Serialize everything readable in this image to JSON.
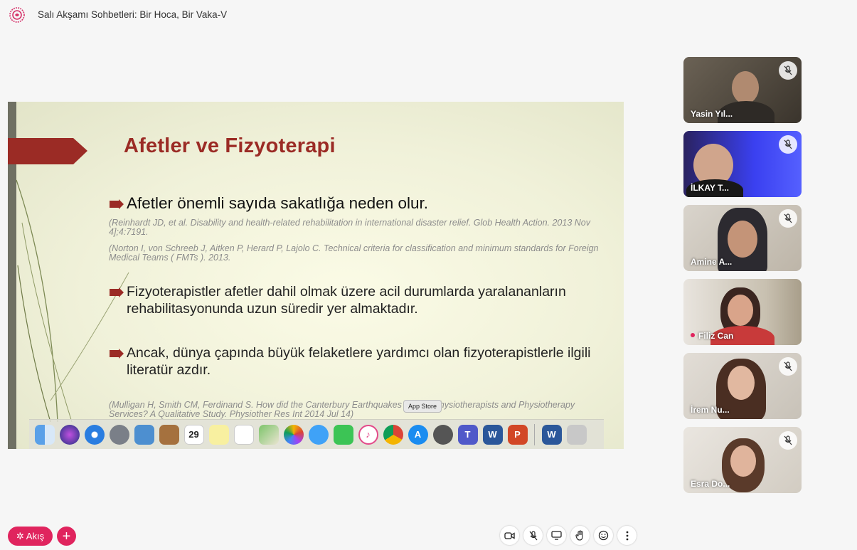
{
  "app": {
    "title": "Salı Akşamı Sohbetleri: Bir Hoca, Bir Vaka-V",
    "accent": "#e0245e"
  },
  "slide": {
    "title": "Afetler ve Fizyoterapi",
    "bullets": [
      "Afetler önemli sayıda sakatlığa neden olur.",
      "Fizyoterapistler afetler dahil olmak üzere acil durumlarda yaralananların rehabilitasyonunda uzun süredir yer almaktadır.",
      "Ancak, dünya çapında büyük felaketlere yardımcı olan fizyoterapistlerle ilgili literatür azdır."
    ],
    "references": [
      "(Reinhardt JD, et al. Disability and health-related rehabilitation in international disaster relief. Glob Health Action. 2013 Nov 4];4:7191.",
      "(Norton I, von Schreeb J, Aitken P, Herard P, Lajolo C. Technical criteria for classification and minimum standards for Foreign Medical Teams ( FMTs ). 2013.",
      "(Mulligan H, Smith CM, Ferdinand S. How did the Canterbury Earthquakes Impact Physiotherapists and Physiotherapy Services? A Qualitative Study. Physiother Res Int 2014 Jul 14)"
    ]
  },
  "dock": {
    "tooltip": "App Store",
    "calendar_day": "29",
    "icons": [
      "finder-icon",
      "siri-icon",
      "safari-icon",
      "launchpad-icon",
      "preview-icon",
      "contacts-icon",
      "calendar-icon",
      "notes-icon",
      "reminders-icon",
      "maps-icon",
      "photos-icon",
      "messages-icon",
      "facetime-icon",
      "itunes-icon",
      "chrome-icon",
      "app-store-icon",
      "system-preferences-icon",
      "teams-icon",
      "word-icon",
      "powerpoint-icon",
      "word-doc-icon",
      "trash-icon"
    ]
  },
  "participants": [
    {
      "name": "Yasin Yıl...",
      "muted": true
    },
    {
      "name": "İLKAY T...",
      "muted": true
    },
    {
      "name": "Amine A...",
      "muted": true
    },
    {
      "name": "Filiz Can",
      "muted": false,
      "speaking": true
    },
    {
      "name": "İrem Nu...",
      "muted": true
    },
    {
      "name": "Esra Do...",
      "muted": true
    }
  ],
  "bottom": {
    "akis_label": "Akış",
    "add_label": "+"
  }
}
